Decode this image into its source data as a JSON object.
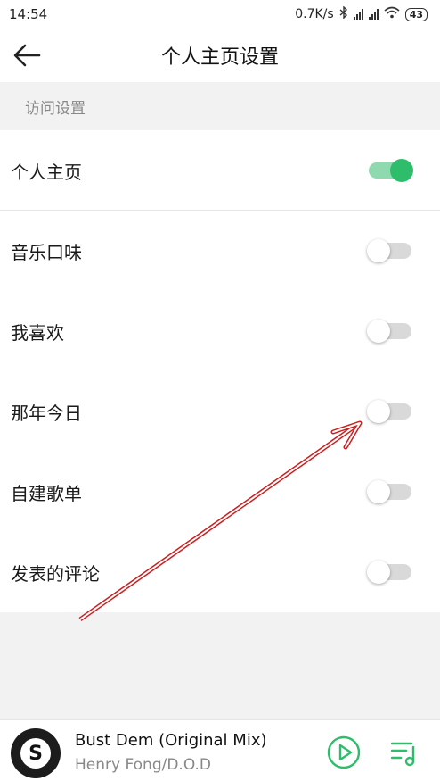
{
  "status_bar": {
    "time": "14:54",
    "network_speed": "0.7K/s",
    "battery": "43"
  },
  "header": {
    "title": "个人主页设置",
    "back_icon": "arrow-left-icon"
  },
  "section": {
    "title": "访问设置"
  },
  "settings": [
    {
      "label": "个人主页",
      "enabled": true
    },
    {
      "label": "音乐口味",
      "enabled": false
    },
    {
      "label": "我喜欢",
      "enabled": false
    },
    {
      "label": "那年今日",
      "enabled": false
    },
    {
      "label": "自建歌单",
      "enabled": false
    },
    {
      "label": "发表的评论",
      "enabled": false
    }
  ],
  "player": {
    "track_title": "Bust Dem (Original Mix)",
    "artist": "Henry Fong/D.O.D",
    "album_logo": "S"
  },
  "colors": {
    "accent": "#2ebd6b",
    "accent_track": "#8fd9ae",
    "annotation_arrow": "#cc1f1f"
  }
}
